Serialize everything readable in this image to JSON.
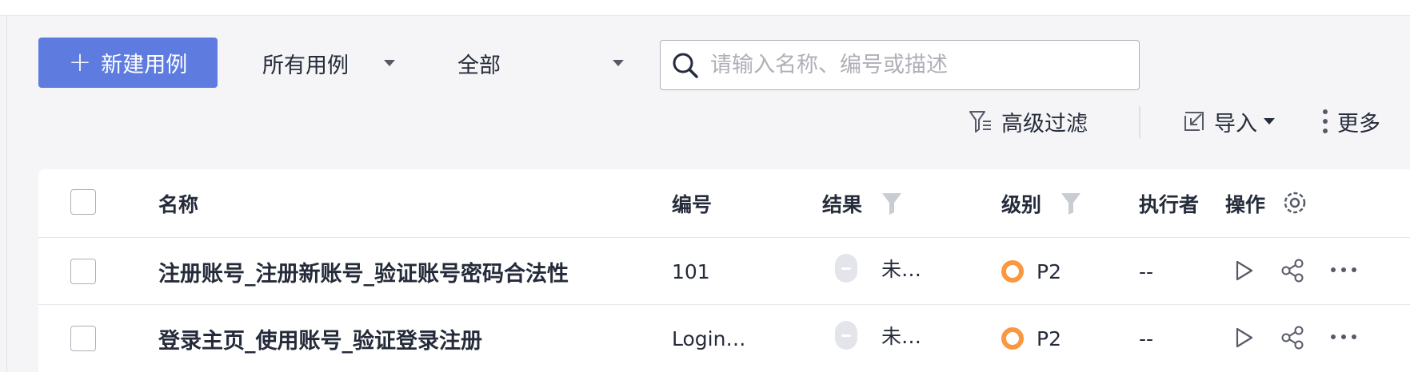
{
  "toolbar": {
    "new_button_label": "新建用例",
    "scope_dropdown": "所有用例",
    "status_dropdown": "全部",
    "search_placeholder": "请输入名称、编号或描述",
    "advanced_filter_label": "高级过滤",
    "import_label": "导入",
    "more_label": "更多"
  },
  "table": {
    "headers": {
      "name": "名称",
      "id": "编号",
      "result": "结果",
      "level": "级别",
      "executor": "执行者",
      "actions": "操作"
    },
    "rows": [
      {
        "name": "注册账号_注册新账号_验证账号密码合法性",
        "id": "101",
        "result": "未…",
        "level": "P2",
        "executor": "--"
      },
      {
        "name": "登录主页_使用账号_验证登录注册",
        "id": "Login…",
        "result": "未…",
        "level": "P2",
        "executor": "--"
      }
    ]
  },
  "colors": {
    "primary": "#5e7ce0",
    "level_ring": "#fa9841",
    "background": "#f5f5f7"
  }
}
